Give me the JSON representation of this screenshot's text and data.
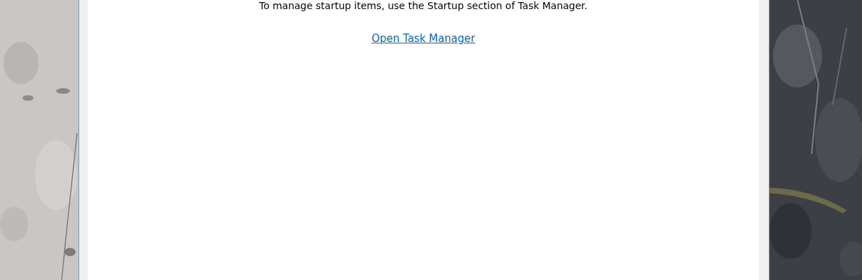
{
  "window": {
    "message": "To manage startup items, use the Startup section of Task Manager.",
    "link": "Open Task Manager"
  }
}
